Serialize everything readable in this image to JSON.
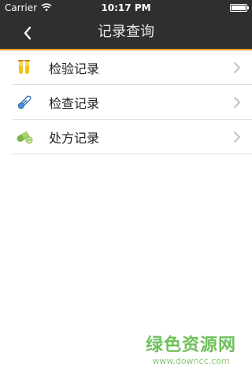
{
  "status_bar": {
    "carrier": "Carrier",
    "time": "10:17 PM"
  },
  "nav": {
    "title": "记录查询",
    "back_icon": "chevron-left-icon"
  },
  "menu": {
    "items": [
      {
        "label": "检验记录",
        "icon": "test-tubes-icon"
      },
      {
        "label": "检查记录",
        "icon": "thermometer-icon"
      },
      {
        "label": "处方记录",
        "icon": "pill-icon"
      }
    ],
    "chevron_icon": "chevron-right-icon"
  },
  "watermark": {
    "title": "绿色资源网",
    "url": "www.downcc.com"
  },
  "colors": {
    "bar_background": "#2f2f2f",
    "accent_orange": "#f29c1f",
    "divider": "#dcdcdc",
    "watermark_green": "#6ec05a"
  }
}
